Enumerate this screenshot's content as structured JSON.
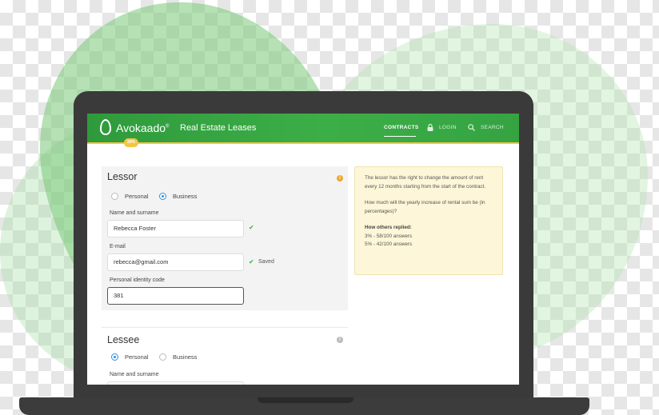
{
  "app": {
    "logo": "Avokaado",
    "logo_reg": "®",
    "badge": "20%",
    "title": "Real Estate Leases"
  },
  "nav": {
    "contracts": "CONTRACTS",
    "login": "LOGIN",
    "search": "SEARCH"
  },
  "lessor": {
    "title": "Lessor",
    "info": "i",
    "type_options": [
      "Personal",
      "Business"
    ],
    "selected_type": "Business",
    "name_label": "Name and surname",
    "name_value": "Rebecca Foster",
    "email_label": "E-mail",
    "email_value": "rebecca@gmail.com",
    "email_status": "Saved",
    "id_label": "Personal identity code",
    "id_value": "381"
  },
  "lessee": {
    "title": "Lessee",
    "info": "i",
    "type_options": [
      "Personal",
      "Business"
    ],
    "selected_type": "Personal",
    "name_label": "Name and surname"
  },
  "tip": {
    "text1": "The lessor has the right to change the amount of rent every 12 months starting from the start of the contract.",
    "text2": "How much will the yearly increase of rental sum be (in percentages)?",
    "others_title": "How others replied:",
    "answers": [
      "3% - 58/100 answers",
      "5% - 42/100 answers"
    ]
  },
  "colors": {
    "brand_green": "#3cae47",
    "accent_yellow": "#f5c542",
    "radio_blue": "#2d8fe0",
    "tip_bg": "#fdf6d8"
  }
}
